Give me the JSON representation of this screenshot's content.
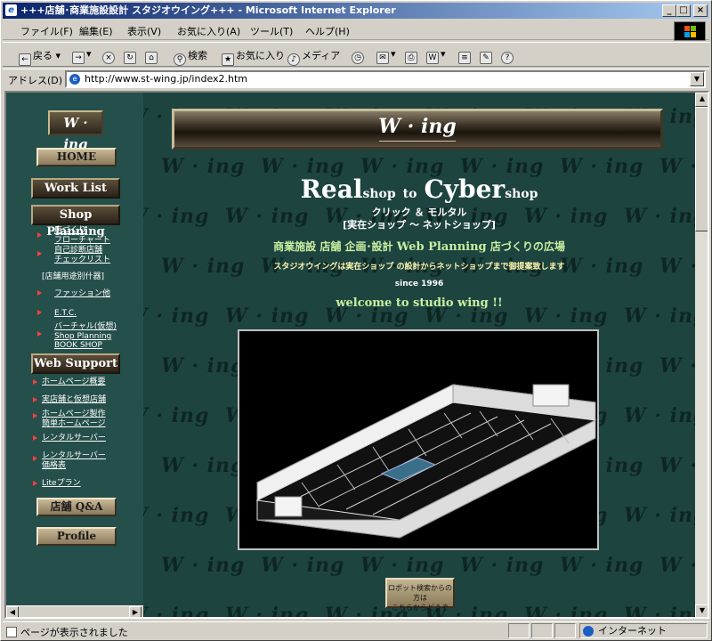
{
  "window": {
    "title": "+++店舗･商業施設設計 スタジオウイング+++ - Microsoft Internet Explorer",
    "buttons": {
      "minimize": "_",
      "maximize": "□",
      "close": "×"
    }
  },
  "menubar": {
    "items": [
      "ファイル(F)",
      "編集(E)",
      "表示(V)",
      "お気に入り(A)",
      "ツール(T)",
      "ヘルプ(H)"
    ]
  },
  "toolbar": {
    "back": "戻る",
    "search": "検索",
    "favorites": "お気に入り",
    "media": "メディア"
  },
  "addressbar": {
    "label": "アドレス(D)",
    "url": "http://www.st-wing.jp/index2.htm"
  },
  "sidebar": {
    "logo": "W · ing",
    "home": "HOME",
    "work_list": "Work List",
    "shop_planning": "Shop Planning",
    "shop_links": [
      {
        "line1": "店づくり",
        "line2": "フローチャート"
      },
      {
        "line1": "自己診断店舗",
        "line2": "チェックリスト"
      }
    ],
    "calc": "[店舗用途別什器]",
    "fashion": "ファッション他",
    "etc": "E.T.C.",
    "virtual": "バーチャル(仮想)",
    "book_shop": {
      "line1": "Shop Planning",
      "line2": "BOOK SHOP"
    },
    "web_support": "Web Support",
    "web_links": [
      {
        "line1": "ホームページ概要",
        "line2": ""
      },
      {
        "line1": "実店舗と仮想店舗",
        "line2": ""
      },
      {
        "line1": "ホームページ製作",
        "line2": "簡単ホームページ"
      },
      {
        "line1": "レンタルサーバー",
        "line2": ""
      },
      {
        "line1": "レンタルサーバー",
        "line2": "価格表"
      },
      {
        "line1": "Liteプラン",
        "line2": ""
      }
    ],
    "qa": "店舗 Q&A",
    "profile": "Profile"
  },
  "main": {
    "banner_logo": "W · ing",
    "watermark": "W · ing",
    "headline": {
      "real": "Real",
      "shop1": "shop",
      "to": "to",
      "cyber": "Cyber",
      "shop2": "shop"
    },
    "sub1": "クリック ＆ モルタル",
    "sub2": "[実在ショップ 〜 ネットショップ]",
    "tagline_jp1": "商業施設 店舗 企画･設計",
    "tagline_en": "Web Planning",
    "tagline_jp2": "店づくりの広場",
    "description": "スタジオウイングは実在ショップ の設計からネットショップまで御提案致します",
    "since": "since 1996",
    "welcome": "welcome to studio wing !!",
    "robot_button": {
      "line1": "ロボット検索からの方は",
      "line2": "こちらからどうぞ"
    }
  },
  "statusbar": {
    "text": "ページが表示されました",
    "zone": "インターネット"
  }
}
